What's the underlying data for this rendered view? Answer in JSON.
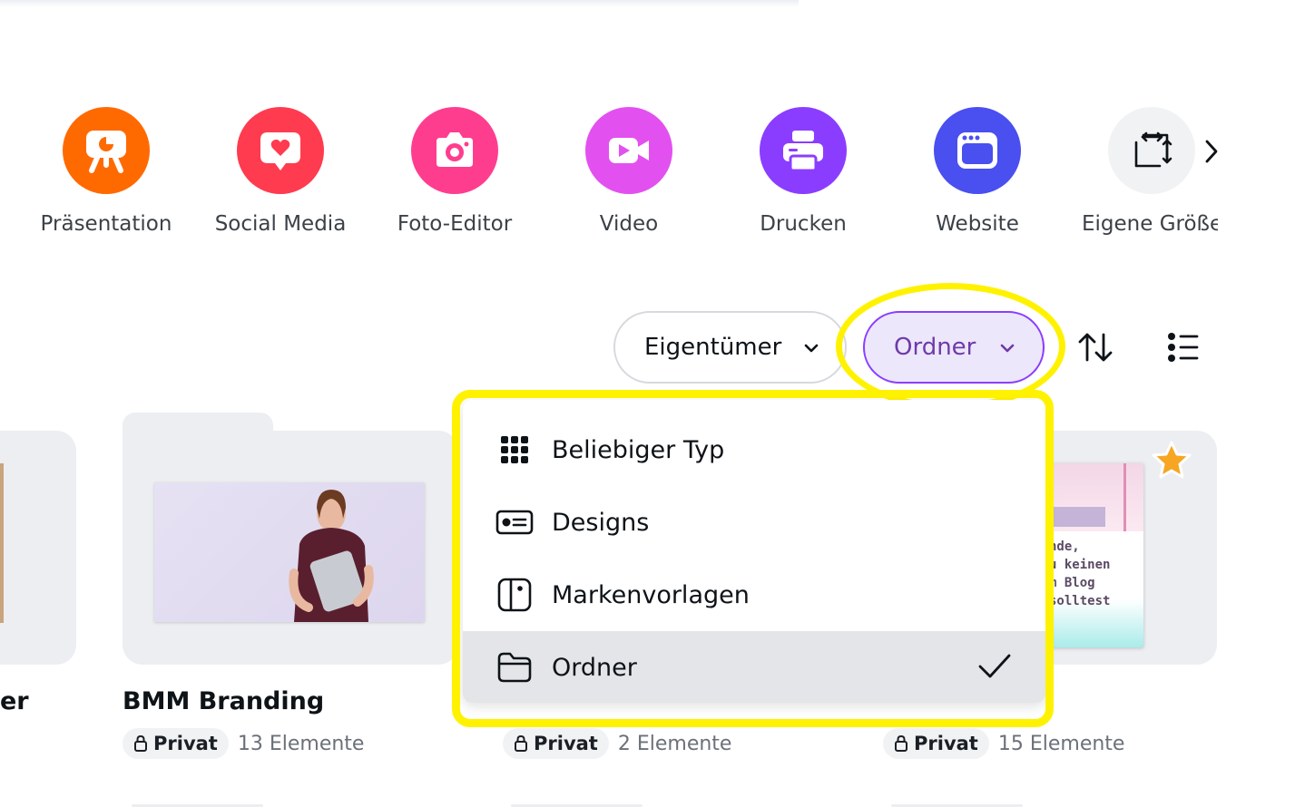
{
  "categories": [
    {
      "label": "Präsentation",
      "icon": "presentation-icon",
      "color": "#ff6a00"
    },
    {
      "label": "Social Media",
      "icon": "heart-chat-icon",
      "color": "#ff3b4f"
    },
    {
      "label": "Foto-Editor",
      "icon": "camera-icon",
      "color": "#ff3d8f"
    },
    {
      "label": "Video",
      "icon": "video-icon",
      "color": "#e350f0"
    },
    {
      "label": "Drucken",
      "icon": "printer-icon",
      "color": "#8b3dff"
    },
    {
      "label": "Website",
      "icon": "website-icon",
      "color": "#4a4ff0"
    },
    {
      "label": "Eigene Größe",
      "icon": "resize-icon",
      "color": "#f1f2f4"
    }
  ],
  "filters": {
    "owner_label": "Eigentümer",
    "type_label": "Ordner",
    "sort_icon": "sort-icon",
    "view_icon": "list-view-icon"
  },
  "type_menu": {
    "items": [
      {
        "label": "Beliebiger Typ",
        "icon": "grid-icon",
        "selected": false
      },
      {
        "label": "Designs",
        "icon": "design-card-icon",
        "selected": false
      },
      {
        "label": "Markenvorlagen",
        "icon": "brand-template-icon",
        "selected": false
      },
      {
        "label": "Ordner",
        "icon": "folder-icon",
        "selected": true
      }
    ]
  },
  "folders": [
    {
      "title": "er",
      "privacy": "",
      "count": ""
    },
    {
      "title": "BMM Branding",
      "privacy": "Privat",
      "count": "13 Elemente"
    },
    {
      "title": "",
      "privacy": "Privat",
      "count": "2 Elemente"
    },
    {
      "title": "",
      "privacy": "Privat",
      "count": "15 Elemente",
      "starred": true
    }
  ],
  "thumbnail_text": [
    "nde,",
    "u keinen",
    "m Blog",
    "solltest"
  ],
  "highlight_color": "#fff200"
}
